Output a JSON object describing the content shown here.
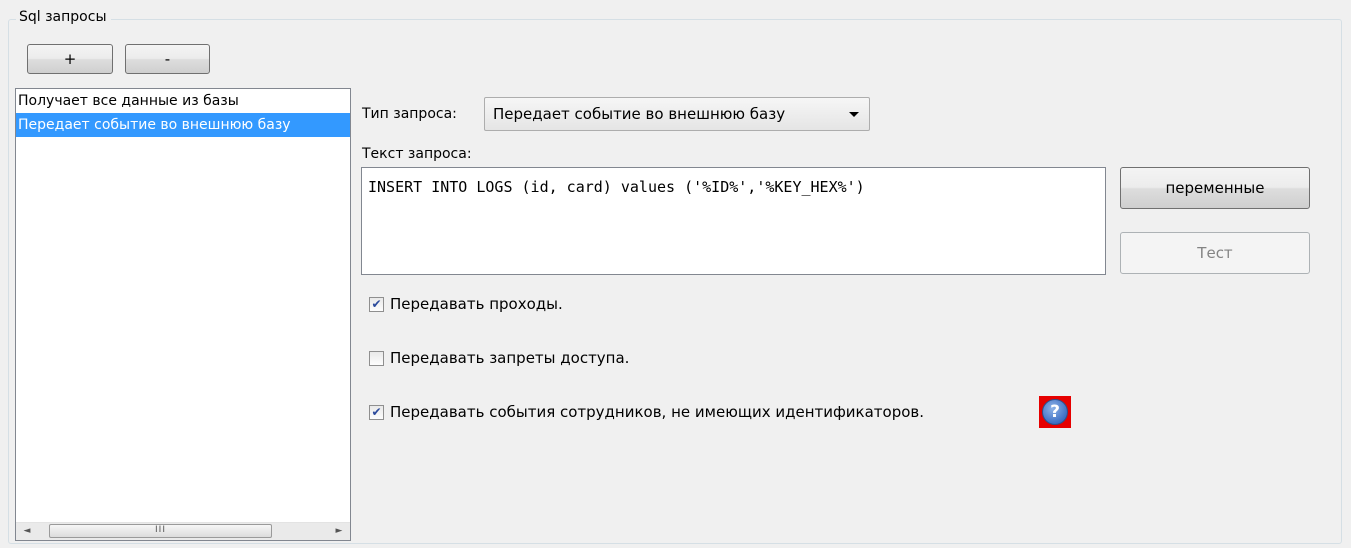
{
  "group": {
    "title": "Sql запросы"
  },
  "toolbar": {
    "add_label": "+",
    "remove_label": "-"
  },
  "queries": {
    "items": [
      {
        "label": "Получает все данные из базы",
        "selected": false
      },
      {
        "label": "Передает событие во внешнюю базу",
        "selected": true
      }
    ]
  },
  "scrollbar": {
    "left_arrow": "◄",
    "thumb_grip": "III",
    "right_arrow": "►"
  },
  "query_type": {
    "label": "Тип запроса:",
    "selected": "Передает событие во внешнюю базу"
  },
  "query_text": {
    "label": "Текст запроса:",
    "value": "INSERT INTO LOGS (id, card) values ('%ID%','%KEY_HEX%')"
  },
  "buttons": {
    "variables_label": "переменные",
    "test_label": "Тест"
  },
  "options": [
    {
      "label": "Передавать проходы.",
      "checked": true
    },
    {
      "label": "Передавать запреты доступа.",
      "checked": false
    },
    {
      "label": "Передавать события сотрудников, не имеющих идентификаторов.",
      "checked": true
    }
  ],
  "help": {
    "icon": "help-icon",
    "glyph": "?"
  },
  "colors": {
    "selection": "#3399ff",
    "help_highlight": "#e60000",
    "help_icon": "#3d6fc4"
  }
}
